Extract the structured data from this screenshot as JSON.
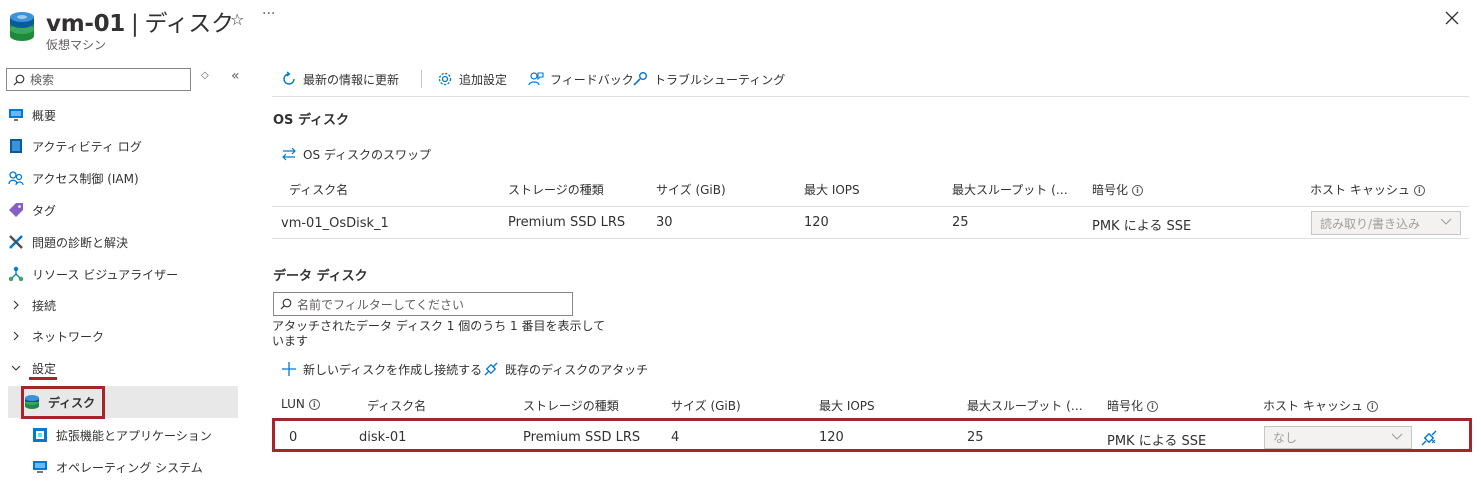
{
  "header": {
    "resource_name": "vm-01",
    "separator": "|",
    "page_name": "ディスク",
    "subtitle": "仮想マシン",
    "favorite_icon": "star-icon",
    "more_icon": "ellipsis-icon",
    "close_icon": "close-icon"
  },
  "sidebar": {
    "search_placeholder": "検索",
    "items": [
      {
        "label": "概要",
        "icon": "monitor-icon"
      },
      {
        "label": "アクティビティ ログ",
        "icon": "log-icon"
      },
      {
        "label": "アクセス制御 (IAM)",
        "icon": "people-icon"
      },
      {
        "label": "タグ",
        "icon": "tag-icon"
      },
      {
        "label": "問題の診断と解決",
        "icon": "wrench-icon"
      },
      {
        "label": "リソース ビジュアライザー",
        "icon": "network-icon"
      },
      {
        "label": "接続",
        "icon": "chevron-right-icon"
      },
      {
        "label": "ネットワーク",
        "icon": "chevron-right-icon"
      },
      {
        "label": "設定",
        "icon": "chevron-down-icon"
      },
      {
        "label": "ディスク",
        "icon": "disk-icon"
      },
      {
        "label": "拡張機能とアプリケーション",
        "icon": "extension-icon"
      },
      {
        "label": "オペレーティング システム",
        "icon": "computer-icon"
      }
    ]
  },
  "toolbar": {
    "refresh": "最新の情報に更新",
    "settings": "追加設定",
    "feedback": "フィードバック",
    "troubleshoot": "トラブルシューティング"
  },
  "os_disk": {
    "section_title": "OS ディスク",
    "swap_label": "OS ディスクのスワップ",
    "columns": [
      "ディスク名",
      "ストレージの種類",
      "サイズ (GiB)",
      "最大 IOPS",
      "最大スループット (…",
      "暗号化",
      "ホスト キャッシュ"
    ],
    "row": {
      "name": "vm-01_OsDisk_1",
      "storage": "Premium SSD LRS",
      "size": "30",
      "iops": "120",
      "throughput": "25",
      "encryption": "PMK による SSE",
      "cache": "読み取り/書き込み"
    }
  },
  "data_disks": {
    "section_title": "データ ディスク",
    "filter_placeholder": "名前でフィルターしてください",
    "count_text_1": "アタッチされたデータ ディスク 1 個のうち 1 番目を表示して",
    "count_text_2": "います",
    "create_label": "新しいディスクを作成し接続する",
    "attach_label": "既存のディスクのアタッチ",
    "columns": [
      "LUN",
      "ディスク名",
      "ストレージの種類",
      "サイズ (GiB)",
      "最大 IOPS",
      "最大スループット (…",
      "暗号化",
      "ホスト キャッシュ"
    ],
    "row": {
      "lun": "0",
      "name": "disk-01",
      "storage": "Premium SSD LRS",
      "size": "4",
      "iops": "120",
      "throughput": "25",
      "encryption": "PMK による SSE",
      "cache": "なし"
    }
  },
  "colors": {
    "accent": "#0078d4",
    "highlight": "#a4262c"
  }
}
